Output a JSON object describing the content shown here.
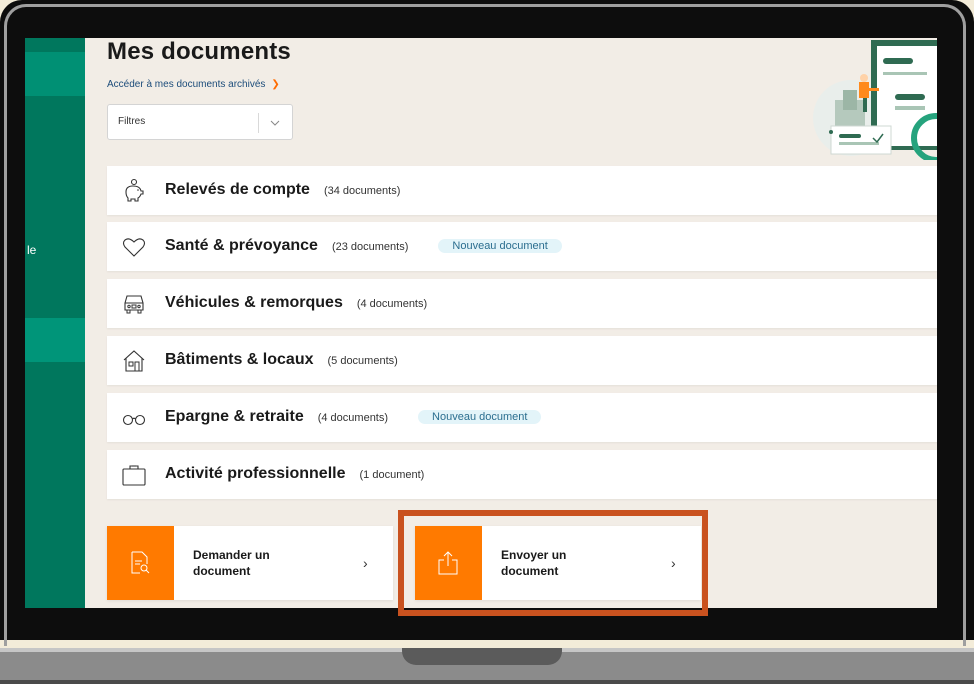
{
  "page": {
    "title": "Mes documents",
    "archive_link": "Accéder à mes documents archivés",
    "sidebar_fragment": "le"
  },
  "filter": {
    "label": "Filtres"
  },
  "categories": [
    {
      "name": "Relevés de compte",
      "count": "(34 documents)",
      "badge": "",
      "icon": "piggy-bank-icon"
    },
    {
      "name": "Santé & prévoyance",
      "count": "(23 documents)",
      "badge": "Nouveau document",
      "icon": "heart-icon"
    },
    {
      "name": "Véhicules & remorques",
      "count": "(4 documents)",
      "badge": "",
      "icon": "car-icon"
    },
    {
      "name": "Bâtiments & locaux",
      "count": "(5 documents)",
      "badge": "",
      "icon": "house-icon"
    },
    {
      "name": "Epargne & retraite",
      "count": "(4 documents)",
      "badge": "Nouveau document",
      "icon": "glasses-icon"
    },
    {
      "name": "Activité professionnelle",
      "count": "(1 document)",
      "badge": "",
      "icon": "briefcase-icon"
    }
  ],
  "actions": {
    "request": {
      "line1": "Demander un",
      "line2": "document",
      "icon": "document-search-icon"
    },
    "send": {
      "line1": "Envoyer un",
      "line2": "document",
      "icon": "upload-icon"
    }
  },
  "colors": {
    "accent": "#ff7a00",
    "sidebar": "#00775d",
    "highlight": "#c9521f",
    "badge_bg": "#e3f4f9"
  }
}
